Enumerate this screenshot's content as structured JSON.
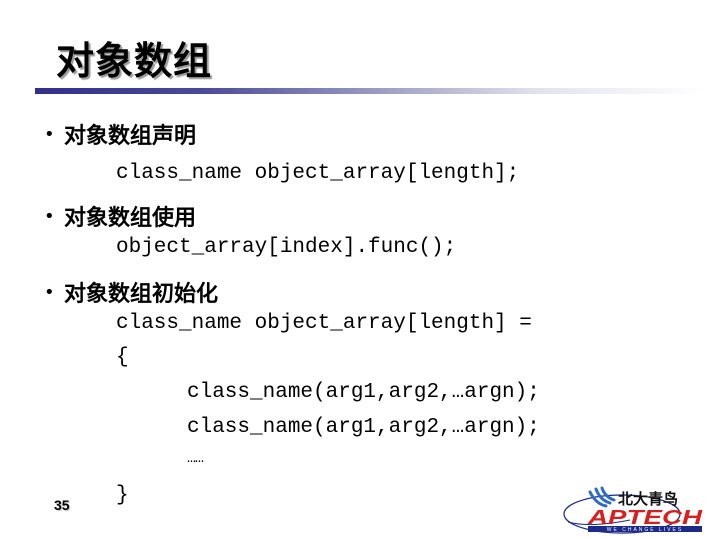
{
  "slide": {
    "title": "对象数组",
    "page_number": "35"
  },
  "sections": [
    {
      "heading": "对象数组声明",
      "code": [
        "class_name object_array[length];"
      ]
    },
    {
      "heading": "对象数组使用",
      "code": [
        "object_array[index].func();"
      ]
    },
    {
      "heading": "对象数组初始化",
      "code": [
        "class_name object_array[length] =",
        "{",
        "class_name(arg1,arg2,…argn);",
        "class_name(arg1,arg2,…argn);",
        "……",
        "}"
      ]
    }
  ],
  "bullet_glyph": "•",
  "logo": {
    "chinese": "北大青鸟",
    "brand": "APTECH",
    "tagline": "WE CHANGE LIVES",
    "colors": {
      "brand_red": "#d81e1e",
      "navy": "#1c2a8a",
      "swoosh_blue": "#2d6ac8"
    }
  },
  "colors": {
    "title_rule": "#30308a"
  }
}
